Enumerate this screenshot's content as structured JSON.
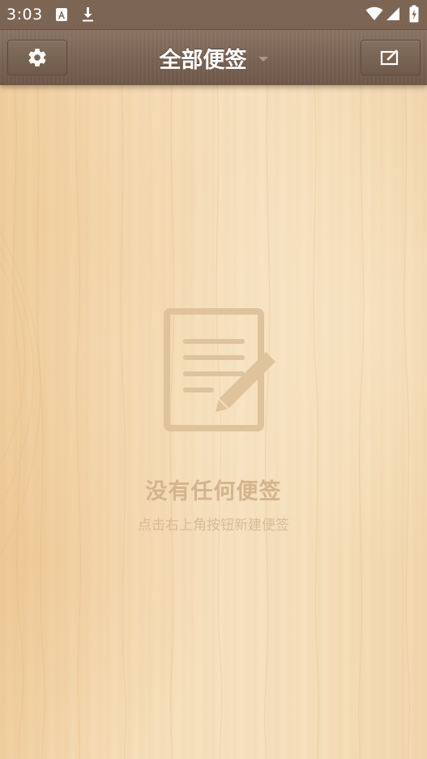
{
  "status_bar": {
    "time": "3:03",
    "icons": [
      "a-notification-icon",
      "download-icon",
      "wifi-icon",
      "signal-icon",
      "battery-icon"
    ]
  },
  "app_bar": {
    "title": "全部便签",
    "settings_icon": "gear-icon",
    "new_note_icon": "compose-icon",
    "dropdown_icon": "caret-down-icon"
  },
  "empty_state": {
    "icon": "note-with-pencil-icon",
    "title": "没有任何便签",
    "hint": "点击右上角按钮新建便签"
  },
  "colors": {
    "status_bar": "#7d6554",
    "app_bar": "#7a6353",
    "wood_light": "#f6e1bf",
    "wood_dark": "#f0cfa0",
    "empty_text": "#d4b48e",
    "empty_icon": "#dcbf98"
  }
}
